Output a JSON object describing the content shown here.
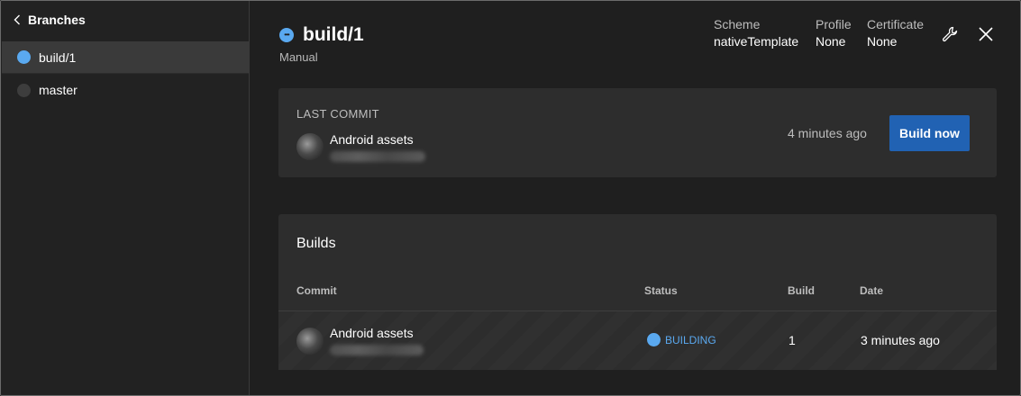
{
  "sidebar": {
    "back_label": "Branches",
    "branches": [
      {
        "name": "build/1",
        "status_color": "#5aa9f0"
      },
      {
        "name": "master",
        "status_color": "#3d3d3d"
      }
    ]
  },
  "header": {
    "branch_title": "build/1",
    "trigger": "Manual",
    "scheme": {
      "label": "Scheme",
      "value": "nativeTemplate"
    },
    "profile": {
      "label": "Profile",
      "value": "None"
    },
    "certificate": {
      "label": "Certificate",
      "value": "None"
    },
    "icons": [
      "wrench-icon",
      "close-icon"
    ]
  },
  "last_commit": {
    "label": "LAST COMMIT",
    "message": "Android assets",
    "time_ago": "4 minutes ago",
    "build_now_label": "Build now"
  },
  "builds": {
    "title": "Builds",
    "columns": [
      "Commit",
      "Status",
      "Build",
      "Date"
    ],
    "rows": [
      {
        "commit_message": "Android assets",
        "status": "BUILDING",
        "build": "1",
        "date": "3 minutes ago"
      }
    ]
  },
  "colors": {
    "accent": "#5aa9f0",
    "button": "#2162b3",
    "background": "#1f1f1f",
    "card": "#2d2d2d"
  }
}
